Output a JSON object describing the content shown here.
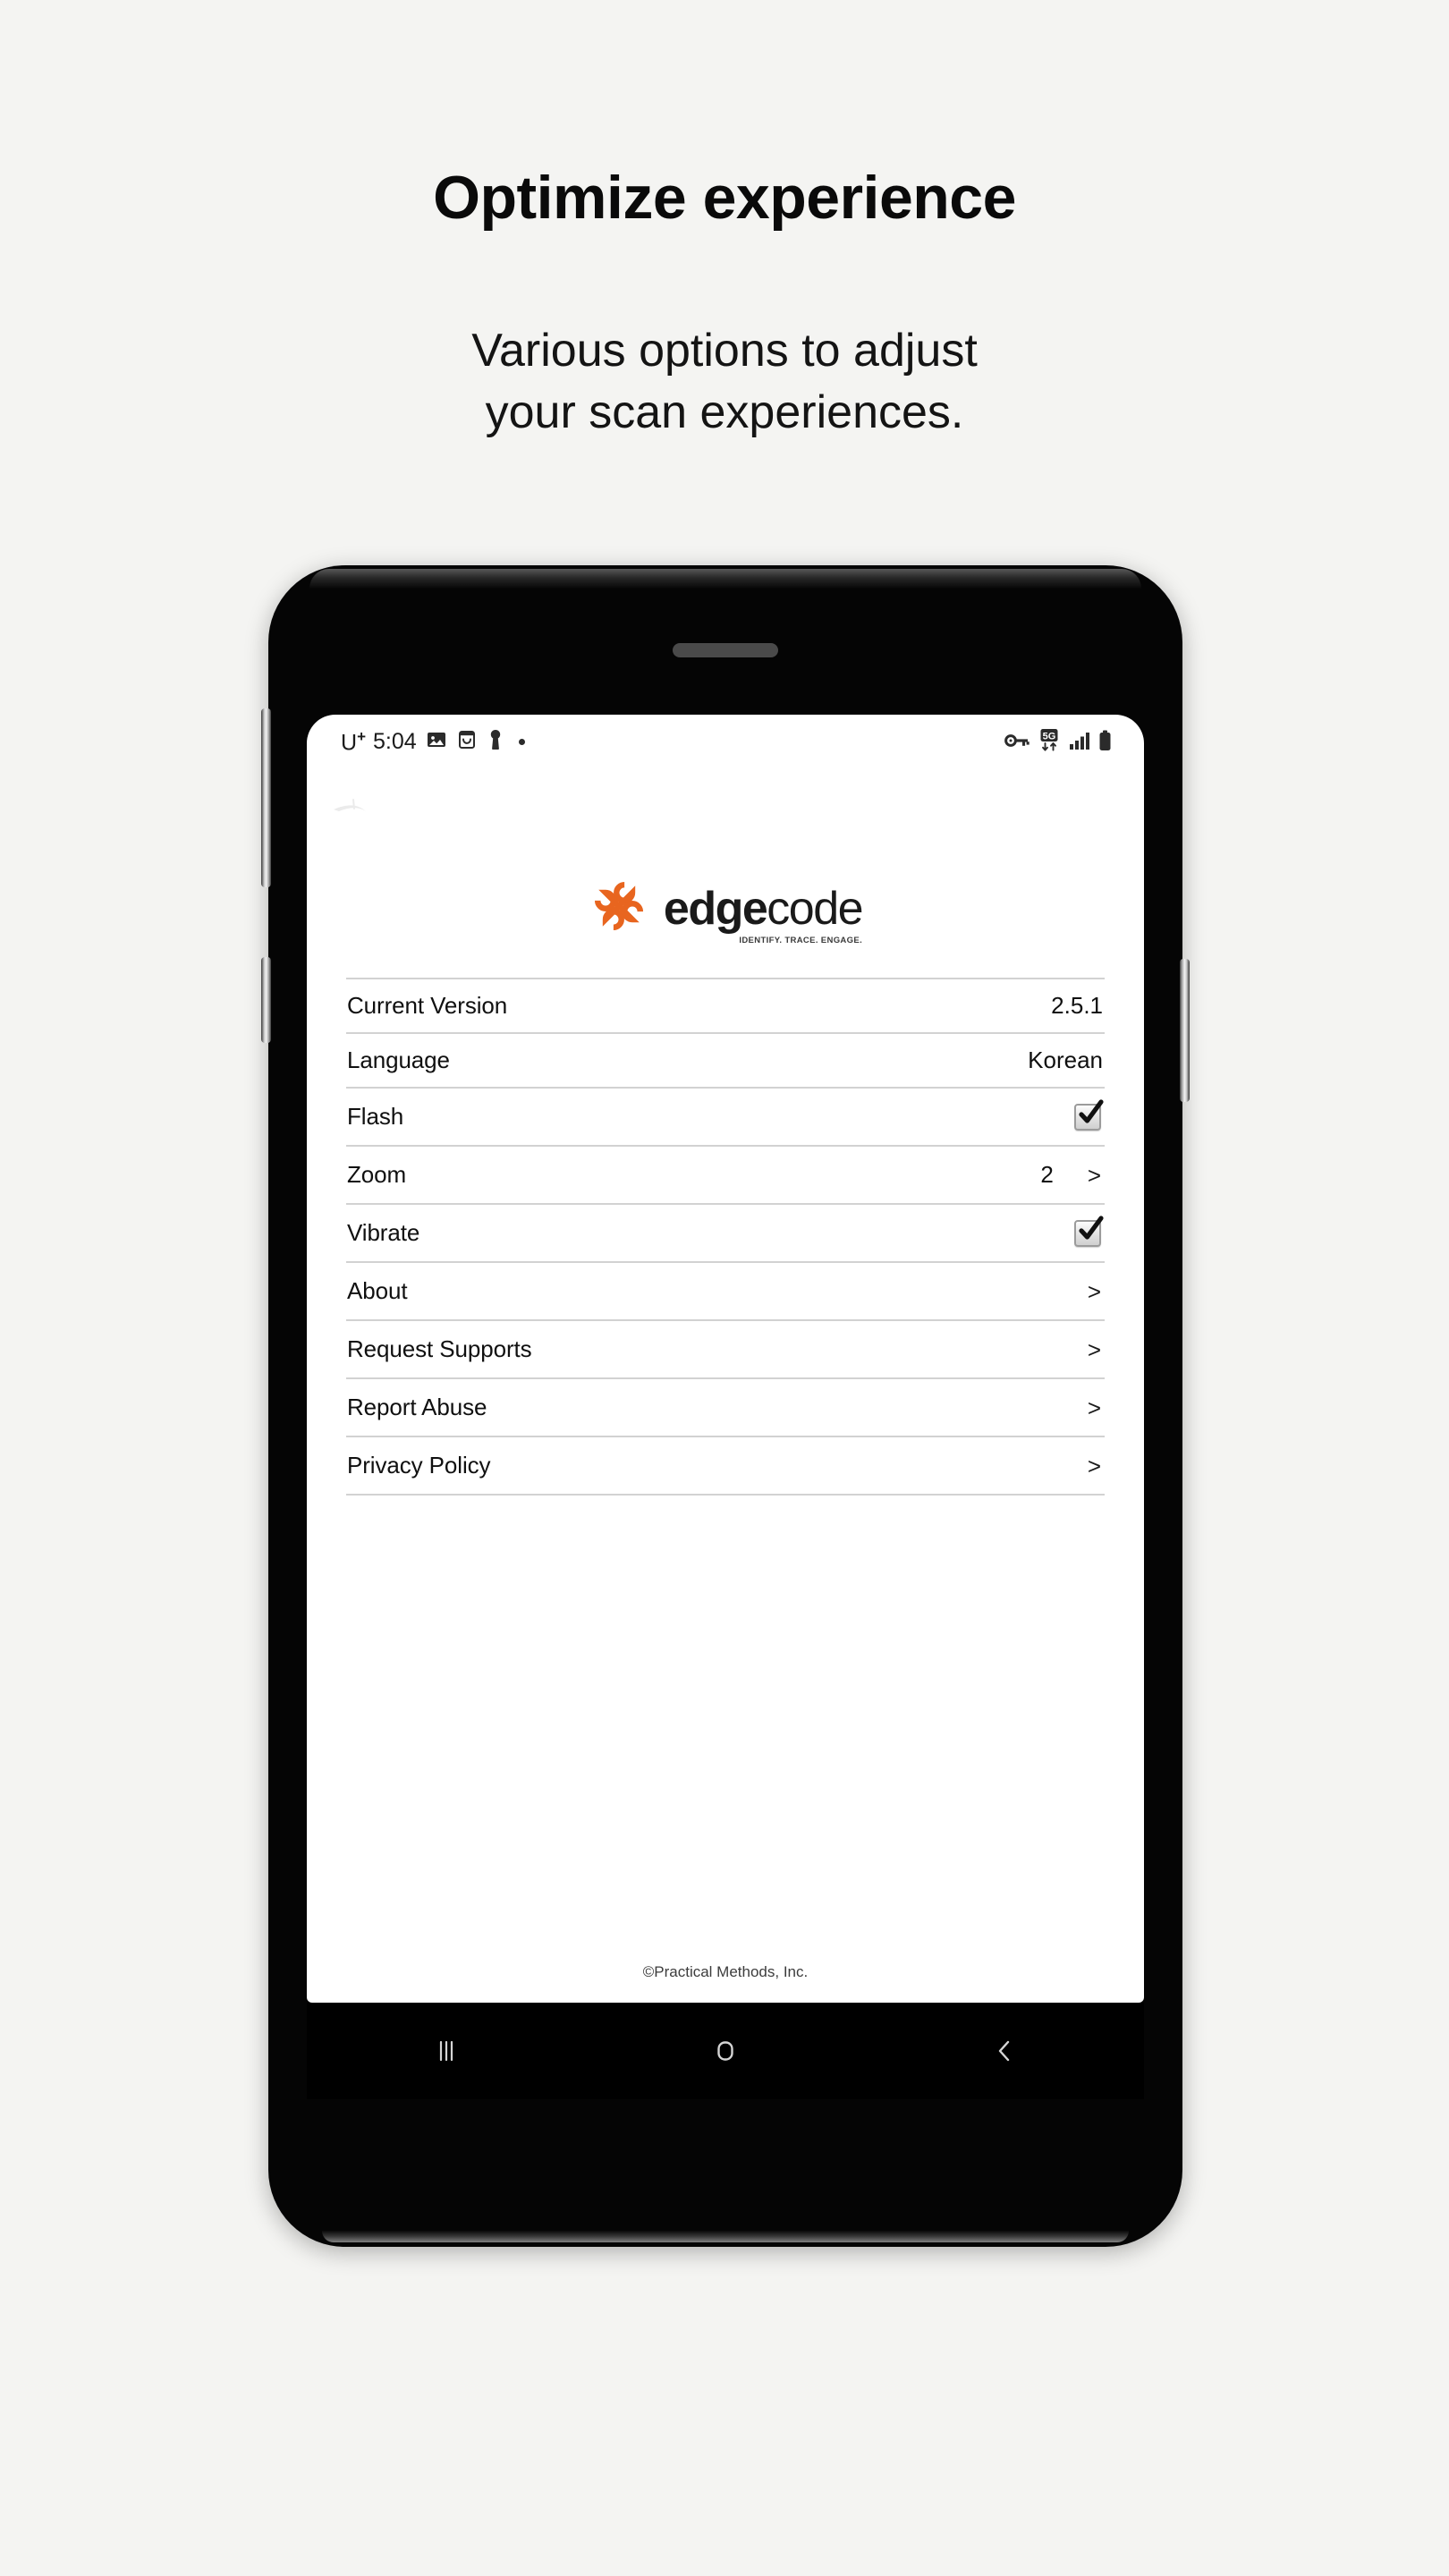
{
  "marketing": {
    "headline": "Optimize experience",
    "subhead_line1": "Various options to adjust",
    "subhead_line2": "your scan experiences."
  },
  "statusbar": {
    "carrier": "U",
    "carrier_superscript": "+",
    "time": "5:04",
    "left_icons": [
      "photo-icon",
      "mail-icon",
      "key-person-icon",
      "dot-indicator"
    ],
    "right_icons": [
      "vpn-key-icon",
      "5g-data-icon",
      "signal-bars-icon",
      "battery-icon"
    ],
    "network_label": "5G"
  },
  "app": {
    "logo_text_primary": "edge",
    "logo_text_secondary": "code",
    "logo_tagline": "IDENTIFY. TRACE. ENGAGE.",
    "logo_color": "#E8651F",
    "footer": "©Practical Methods, Inc."
  },
  "settings": {
    "rows": [
      {
        "label": "Current Version",
        "value": "2.5.1",
        "control": "text"
      },
      {
        "label": "Language",
        "value": "Korean",
        "control": "text"
      },
      {
        "label": "Flash",
        "value": "",
        "control": "checkbox",
        "checked": true
      },
      {
        "label": "Zoom",
        "value": "2",
        "control": "chevron",
        "chevron": ">"
      },
      {
        "label": "Vibrate",
        "value": "",
        "control": "checkbox",
        "checked": true
      },
      {
        "label": "About",
        "value": "",
        "control": "chevron",
        "chevron": ">"
      },
      {
        "label": "Request Supports",
        "value": "",
        "control": "chevron",
        "chevron": ">"
      },
      {
        "label": "Report Abuse",
        "value": "",
        "control": "chevron",
        "chevron": ">"
      },
      {
        "label": "Privacy Policy",
        "value": "",
        "control": "chevron",
        "chevron": ">"
      }
    ]
  },
  "navbar": {
    "recents_label": "recents-icon",
    "home_label": "home-icon",
    "back_label": "back-icon"
  },
  "theme": {
    "page_background": "#f4f4f2",
    "accent": "#E8651F",
    "divider": "#d2d2d2"
  }
}
